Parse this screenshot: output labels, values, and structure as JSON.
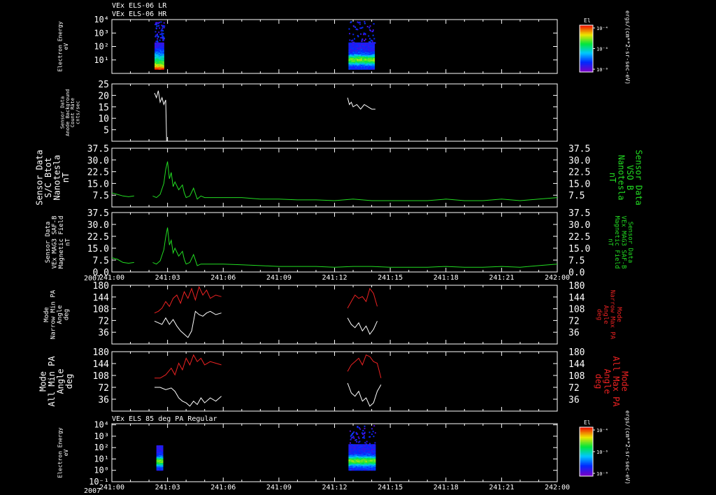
{
  "colors": {
    "background": "#000000",
    "axis": "#ffffff",
    "green": "#22dd22",
    "red": "#ee2222",
    "white": "#ffffff"
  },
  "header": {
    "title_line1": "VEx ELS-06 LR",
    "title_line2": "VEx ELS-06 HR",
    "year_label": "2007",
    "time_ticks": [
      "241:00",
      "241:03",
      "241:06",
      "241:09",
      "241:12",
      "241:15",
      "241:18",
      "241:21",
      "242:00"
    ]
  },
  "colorbar": {
    "title": "El",
    "units": "ergs/(cm**2-sr-sec-eV)",
    "tick_labels": [
      "10⁻⁴",
      "10⁻⁶",
      "10⁻⁸"
    ]
  },
  "bottom_panel_title": "VEx ELS 85 deg PA Regular",
  "chart_data": [
    {
      "type": "heatmap",
      "id": "electron-energy-top",
      "ylabel_lines": [
        "Electron Energy",
        "eV"
      ],
      "y_scale": "log",
      "ytick_labels": [
        "10⁴",
        "10³",
        "10²",
        "10¹"
      ],
      "xlim": [
        0,
        24
      ],
      "blocks": [
        {
          "x0": 2.3,
          "x1": 2.8,
          "ymin_log": 0.3,
          "ymax_log": 2.3,
          "sparse_top": true,
          "peak": "low"
        },
        {
          "x0": 12.75,
          "x1": 14.15,
          "ymin_log": 0.3,
          "ymax_log": 2.3,
          "sparse_top": true,
          "peak": "mid"
        }
      ]
    },
    {
      "type": "line",
      "id": "anode-background",
      "ylabel_lines": [
        "Sensor Data",
        "Anode Background",
        "Count Rate",
        "cnts/sec"
      ],
      "ylim": [
        0,
        25
      ],
      "ytick_values": [
        5,
        10,
        15,
        20,
        25
      ],
      "series": [
        {
          "color": "white",
          "x": [
            2.3,
            2.4,
            2.5,
            2.6,
            2.7,
            2.8,
            2.9,
            2.95
          ],
          "y": [
            21,
            19,
            22,
            17,
            19,
            16,
            18,
            0
          ]
        },
        {
          "color": "white",
          "x": [
            12.7,
            12.8,
            12.9,
            13.0,
            13.2,
            13.4,
            13.6,
            13.8,
            14.0,
            14.2
          ],
          "y": [
            19,
            16,
            17,
            15,
            16,
            14,
            16,
            15,
            14,
            14
          ]
        }
      ]
    },
    {
      "type": "line",
      "id": "sc-btot",
      "ylabel_lines": [
        "Sensor Data",
        "S/C Btot",
        "Nanotesla",
        "nT"
      ],
      "right_label_lines": [
        "Sensor Data",
        "VSO B",
        "Nanotesla",
        "nT"
      ],
      "ylim": [
        0,
        37.5
      ],
      "ytick_labels": [
        "7.5",
        "15.0",
        "22.5",
        "30.0",
        "37.5"
      ],
      "ytick_values": [
        7.5,
        15,
        22.5,
        30,
        37.5
      ],
      "series": [
        {
          "color": "green",
          "x": [
            0,
            0.3,
            0.6,
            0.9,
            1.2
          ],
          "y": [
            9,
            8,
            7,
            6.5,
            7
          ]
        },
        {
          "color": "green",
          "x": [
            2.2,
            2.4,
            2.6,
            2.8,
            2.9,
            3.0,
            3.1,
            3.2,
            3.3,
            3.4,
            3.6,
            3.8,
            3.9,
            4.0,
            4.2,
            4.4,
            4.6,
            4.8,
            5.0,
            6,
            7,
            8,
            9,
            10,
            11,
            12,
            13,
            14,
            15,
            16,
            17,
            18,
            19,
            20,
            21,
            22,
            23,
            24
          ],
          "y": [
            7,
            6,
            8,
            15,
            24,
            29,
            18,
            22,
            13,
            16,
            11,
            14,
            9,
            6,
            7,
            12,
            5,
            7,
            6,
            6,
            6,
            5,
            5,
            4.5,
            4.5,
            4,
            5,
            4,
            4,
            4,
            4,
            5,
            4,
            4,
            5,
            4,
            5,
            6
          ]
        }
      ]
    },
    {
      "type": "line",
      "id": "mag-saf-b",
      "ylabel_lines": [
        "Sensor Data",
        "VEx MAG3 SAF-B",
        "Magnetic Field",
        "nT"
      ],
      "right_label_lines": [
        "Sensor Data",
        "VEx MAG3 SAF-B",
        "Magnetic Field",
        "nT"
      ],
      "ylim": [
        0,
        37.5
      ],
      "ytick_labels": [
        "0.0",
        "7.5",
        "15.0",
        "22.5",
        "30.0",
        "37.5"
      ],
      "ytick_values": [
        0,
        7.5,
        15,
        22.5,
        30,
        37.5
      ],
      "series": [
        {
          "color": "green",
          "x": [
            0,
            0.3,
            0.6,
            0.9,
            1.2
          ],
          "y": [
            9,
            8,
            6,
            5.5,
            6
          ]
        },
        {
          "color": "green",
          "x": [
            2.2,
            2.4,
            2.6,
            2.8,
            2.9,
            3.0,
            3.1,
            3.2,
            3.3,
            3.4,
            3.6,
            3.8,
            3.9,
            4.0,
            4.2,
            4.4,
            4.6,
            4.8,
            5.0,
            6,
            7,
            8,
            9,
            10,
            11,
            12,
            13,
            14,
            15,
            16,
            17,
            18,
            19,
            20,
            21,
            22,
            23,
            24
          ],
          "y": [
            6,
            5,
            7,
            14,
            22,
            28,
            17,
            20,
            12,
            15,
            10,
            13,
            8,
            5,
            6,
            11,
            4,
            5,
            5,
            5,
            4.5,
            4,
            3.5,
            3.5,
            3.5,
            3,
            3.5,
            3.5,
            3,
            3,
            3,
            3.5,
            3,
            3,
            3.5,
            3,
            4,
            5
          ]
        }
      ]
    },
    {
      "type": "line",
      "id": "narrow-pa",
      "ylabel_lines": [
        "Mode",
        "Narrow Min PA",
        "Angle",
        "deg"
      ],
      "right_label_lines": [
        "Mode",
        "Narrow Max PA",
        "Angle",
        "deg"
      ],
      "ylim": [
        0,
        180
      ],
      "ytick_values": [
        36,
        72,
        108,
        144,
        180
      ],
      "series": [
        {
          "color": "red",
          "x": [
            2.3,
            2.5,
            2.7,
            2.9,
            3.1,
            3.3,
            3.5,
            3.7,
            3.9,
            4.1,
            4.3,
            4.5,
            4.7,
            4.9,
            5.1,
            5.3,
            5.6,
            5.9
          ],
          "y": [
            95,
            100,
            110,
            130,
            115,
            140,
            150,
            125,
            160,
            140,
            170,
            135,
            175,
            150,
            165,
            140,
            150,
            145
          ]
        },
        {
          "color": "white",
          "x": [
            2.3,
            2.5,
            2.7,
            2.9,
            3.1,
            3.3,
            3.5,
            3.7,
            3.9,
            4.1,
            4.3,
            4.5,
            4.7,
            4.9,
            5.1,
            5.3,
            5.6,
            5.9
          ],
          "y": [
            70,
            65,
            60,
            80,
            60,
            75,
            55,
            40,
            30,
            20,
            40,
            100,
            90,
            85,
            95,
            100,
            90,
            95
          ]
        },
        {
          "color": "red",
          "x": [
            12.7,
            12.9,
            13.1,
            13.3,
            13.5,
            13.7,
            13.9,
            14.1,
            14.3
          ],
          "y": [
            110,
            130,
            150,
            140,
            145,
            130,
            170,
            155,
            115
          ]
        },
        {
          "color": "white",
          "x": [
            12.7,
            12.9,
            13.1,
            13.3,
            13.5,
            13.7,
            13.9,
            14.1,
            14.3
          ],
          "y": [
            80,
            60,
            50,
            65,
            40,
            55,
            30,
            45,
            70
          ]
        }
      ]
    },
    {
      "type": "line",
      "id": "all-pa",
      "ylabel_lines": [
        "Mode",
        "All Min PA",
        "Angle",
        "deg"
      ],
      "right_label_lines": [
        "Mode",
        "All Max PA",
        "Angle",
        "deg"
      ],
      "ylim": [
        0,
        180
      ],
      "ytick_values": [
        36,
        72,
        108,
        144,
        180
      ],
      "series": [
        {
          "color": "red",
          "x": [
            2.3,
            2.6,
            2.9,
            3.2,
            3.4,
            3.6,
            3.8,
            4.0,
            4.2,
            4.4,
            4.6,
            4.8,
            5.0,
            5.3,
            5.6,
            5.9
          ],
          "y": [
            100,
            100,
            110,
            130,
            110,
            145,
            125,
            160,
            140,
            170,
            150,
            160,
            140,
            150,
            145,
            140
          ]
        },
        {
          "color": "white",
          "x": [
            2.3,
            2.6,
            2.9,
            3.2,
            3.4,
            3.6,
            3.8,
            4.0,
            4.2,
            4.4,
            4.6,
            4.8,
            5.0,
            5.3,
            5.6,
            5.9
          ],
          "y": [
            72,
            72,
            65,
            70,
            60,
            40,
            30,
            25,
            15,
            30,
            20,
            40,
            25,
            40,
            30,
            45
          ]
        },
        {
          "color": "red",
          "x": [
            12.7,
            12.9,
            13.1,
            13.3,
            13.5,
            13.7,
            13.9,
            14.1,
            14.3,
            14.5
          ],
          "y": [
            120,
            140,
            150,
            160,
            140,
            170,
            165,
            150,
            145,
            100
          ]
        },
        {
          "color": "white",
          "x": [
            12.7,
            12.9,
            13.1,
            13.3,
            13.5,
            13.7,
            13.9,
            14.1,
            14.3,
            14.5
          ],
          "y": [
            85,
            55,
            45,
            60,
            30,
            40,
            15,
            25,
            60,
            80
          ]
        }
      ]
    },
    {
      "type": "heatmap",
      "id": "electron-energy-bottom",
      "ylabel_lines": [
        "Electron Energy",
        "eV"
      ],
      "y_scale": "log",
      "ytick_labels": [
        "10⁴",
        "10³",
        "10²",
        "10¹",
        "10⁰",
        "10⁻¹"
      ],
      "xlim": [
        0,
        24
      ],
      "blocks": [
        {
          "x0": 2.4,
          "x1": 2.75,
          "ymin_log": 0.0,
          "ymax_log": 2.2,
          "sparse_top": false,
          "peak": "mid"
        },
        {
          "x0": 12.75,
          "x1": 14.2,
          "ymin_log": 0.0,
          "ymax_log": 2.3,
          "sparse_top": true,
          "peak": "mid"
        }
      ]
    }
  ]
}
